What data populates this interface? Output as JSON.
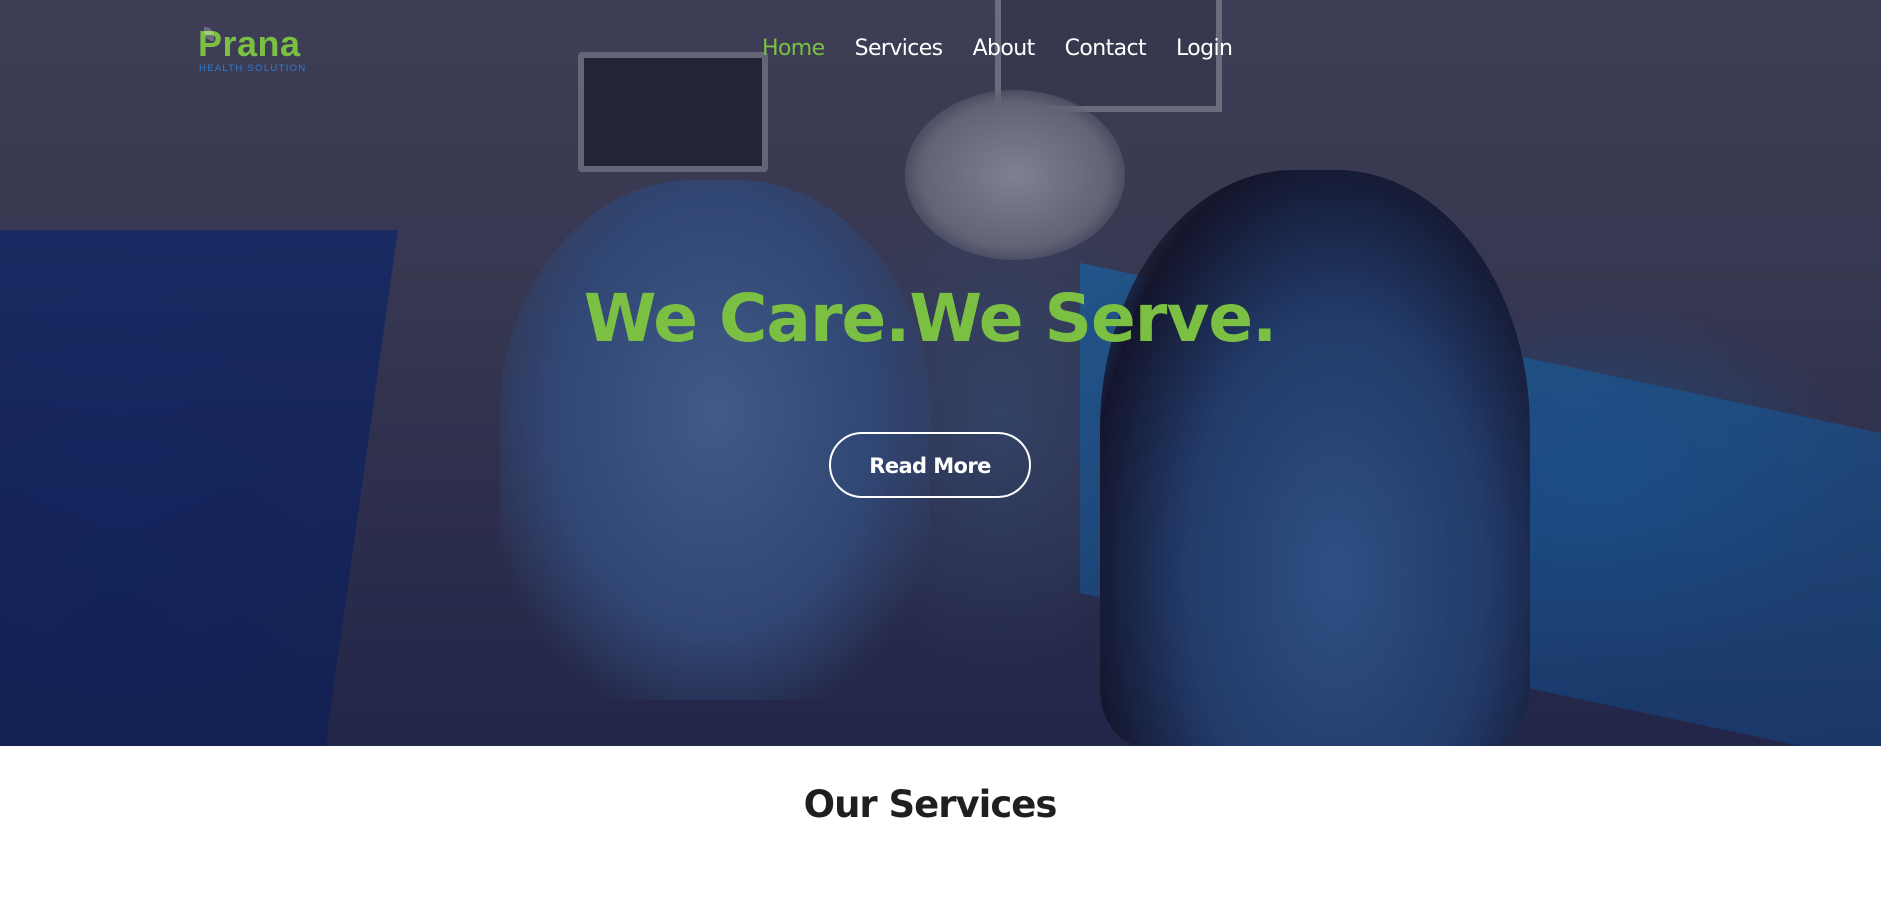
{
  "logo": {
    "name": "Prana",
    "tagline": "HEALTH SOLUTION"
  },
  "nav": {
    "items": [
      {
        "label": "Home",
        "active": true
      },
      {
        "label": "Services",
        "active": false
      },
      {
        "label": "About",
        "active": false
      },
      {
        "label": "Contact",
        "active": false
      },
      {
        "label": "Login",
        "active": false
      }
    ]
  },
  "hero": {
    "title": "We Care.We Serve.",
    "button_label": "Read More"
  },
  "services": {
    "title": "Our Services"
  },
  "colors": {
    "accent": "#7bc043",
    "tagline_blue": "#2d7fd1",
    "nav_text": "#ffffff",
    "section_title": "#1f1f1f"
  }
}
